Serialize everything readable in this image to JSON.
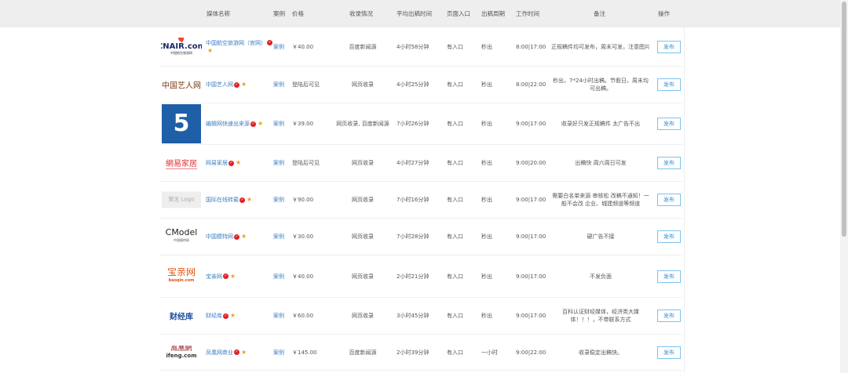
{
  "header": {
    "logo": "",
    "name": "媒体名称",
    "case": "案例",
    "price": "价格",
    "index": "收录情况",
    "avg": "平均出稿时间",
    "entry": "页面入口",
    "cycle": "出稿周期",
    "work": "工作时间",
    "note": "备注",
    "action": "操作"
  },
  "rows": [
    {
      "logo": "CNAIR.com",
      "logo_sub": "中国航空旅游网",
      "name": "中国航空旅游网（官网）",
      "case": "案例",
      "price": "￥40.00",
      "index": "百度新闻源",
      "avg": "4小时58分钟",
      "entry": "有入口",
      "cycle": "秒出",
      "work": "8:00|17:00",
      "note": "正规稿件均可发布，周末可发，注意图片",
      "action": "发布"
    },
    {
      "logo": "中国艺人网",
      "name": "中国艺人网",
      "case": "案例",
      "price": "登陆后可见",
      "index": "网页收录",
      "avg": "4小时25分钟",
      "entry": "有入口",
      "cycle": "秒出",
      "work": "8:00|22:00",
      "note": "秒出，7*24小时出稿。节假日，周末均可出稿。",
      "action": "发布"
    },
    {
      "logo": "5",
      "name": "编辑网快速出来源",
      "case": "案例",
      "price": "￥39.00",
      "index": "网页收录, 百度新闻源",
      "avg": "7小时26分钟",
      "entry": "有入口",
      "cycle": "秒出",
      "work": "9:00|17:00",
      "note": "收录好只发正规稿件 太广告不出",
      "action": "发布"
    },
    {
      "logo": "網易家居",
      "name": "网易家居",
      "case": "案例",
      "price": "登陆后可见",
      "index": "网页收录",
      "avg": "4小时27分钟",
      "entry": "有入口",
      "cycle": "秒出",
      "work": "9:00|20:00",
      "note": "出稿快 周六周日可发",
      "action": "发布"
    },
    {
      "logo": "暂无 Logo",
      "name": "国际在线转载",
      "case": "案例",
      "price": "￥90.00",
      "index": "网页收录",
      "avg": "7小时16分钟",
      "entry": "有入口",
      "cycle": "秒出",
      "work": "9:00|17:00",
      "note": "需要白名单来源 审核松 改稿不通知！一般不会改 企业、城建频道等频道",
      "action": "发布"
    },
    {
      "logo": "CModel",
      "logo_sub": "中国模特网",
      "name": "中国模特网",
      "case": "案例",
      "price": "￥30.00",
      "index": "网页收录",
      "avg": "7小时28分钟",
      "entry": "有入口",
      "cycle": "秒出",
      "work": "9:00|17:00",
      "note": "硬广告不接",
      "action": "发布"
    },
    {
      "logo": "宝亲网",
      "logo_sub": "baoqin.com",
      "name": "宝亲网",
      "case": "案例",
      "price": "￥40.00",
      "index": "网页收录",
      "avg": "2小时21分钟",
      "entry": "有入口",
      "cycle": "秒出",
      "work": "9:00|17:00",
      "note": "不发负面",
      "action": "发布"
    },
    {
      "logo": "财经库",
      "name": "财经库",
      "case": "案例",
      "price": "￥60.00",
      "index": "网页收录",
      "avg": "3小时45分钟",
      "entry": "有入口",
      "cycle": "秒出",
      "work": "9:00|17:00",
      "note": "百科认证财经媒体，经济类大媒体！！！，不带联系方式",
      "action": "发布"
    },
    {
      "logo": "鳳凰網",
      "logo_sub": "ifeng.com",
      "name": "凤凰网商业",
      "case": "案例",
      "price": "￥145.00",
      "index": "百度新闻源",
      "avg": "2小时39分钟",
      "entry": "有入口",
      "cycle": "一小时",
      "work": "9:00|22:00",
      "note": "收录稳定出稿快。",
      "action": "发布"
    }
  ],
  "colors": {
    "link": "#3b7fc4",
    "button_border": "#7cc3f0",
    "verified": "#e02020",
    "star": "#f0a020"
  }
}
